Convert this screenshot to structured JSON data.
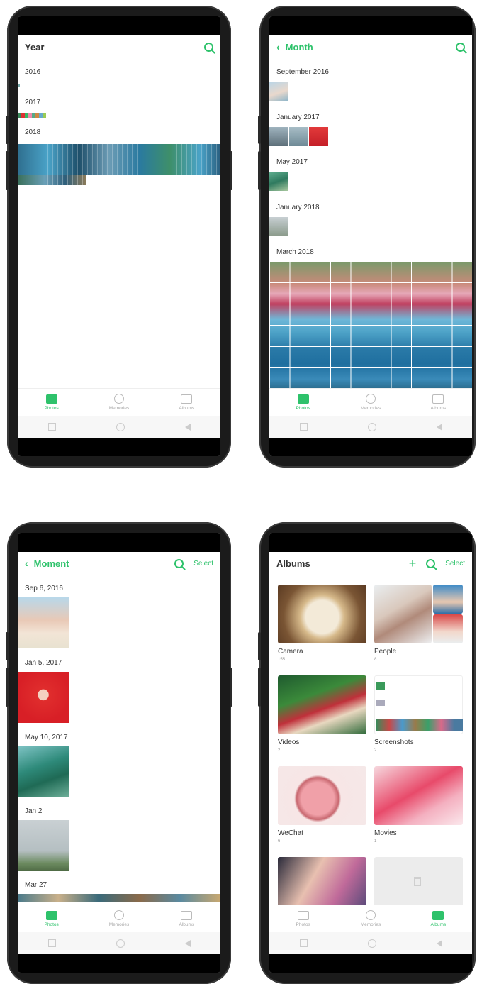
{
  "colors": {
    "accent": "#2ec26b"
  },
  "screens": {
    "year": {
      "title": "Year",
      "sections": [
        {
          "label": "2016"
        },
        {
          "label": "2017"
        },
        {
          "label": "2018"
        }
      ]
    },
    "month": {
      "title": "Month",
      "sections": [
        {
          "label": "September 2016"
        },
        {
          "label": "January 2017"
        },
        {
          "label": "May 2017"
        },
        {
          "label": "January 2018"
        },
        {
          "label": "March 2018"
        }
      ]
    },
    "moment": {
      "title": "Moment",
      "select_label": "Select",
      "sections": [
        {
          "label": "Sep 6, 2016"
        },
        {
          "label": "Jan 5, 2017"
        },
        {
          "label": "May 10, 2017"
        },
        {
          "label": "Jan 2"
        },
        {
          "label": "Mar 27"
        }
      ]
    },
    "albums": {
      "title": "Albums",
      "select_label": "Select",
      "items": [
        {
          "name": "Camera",
          "count": "155"
        },
        {
          "name": "People",
          "count": "8"
        },
        {
          "name": "Videos",
          "count": "2"
        },
        {
          "name": "Screenshots",
          "count": "2"
        },
        {
          "name": "WeChat",
          "count": "6"
        },
        {
          "name": "Movies",
          "count": "1"
        }
      ]
    }
  },
  "tabs": [
    {
      "label": "Photos"
    },
    {
      "label": "Memories"
    },
    {
      "label": "Albums"
    }
  ]
}
